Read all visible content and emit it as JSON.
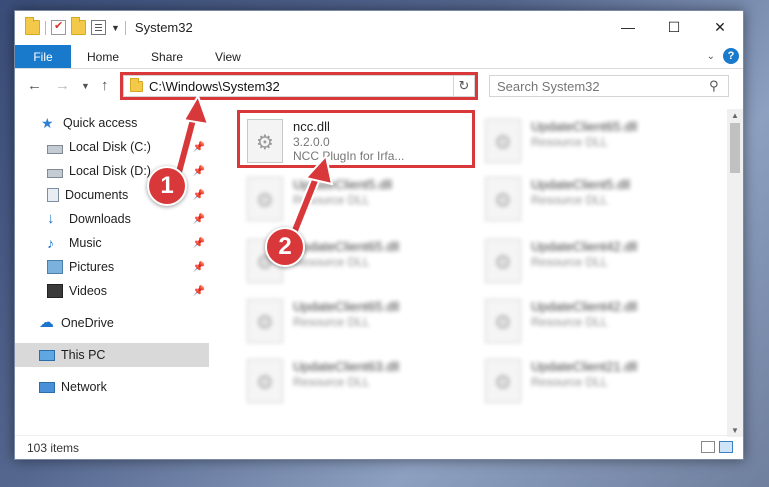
{
  "window": {
    "title": "System32",
    "controls": {
      "minimize": "—",
      "maximize": "☐",
      "close": "✕"
    }
  },
  "ribbon": {
    "tabs": [
      "File",
      "Home",
      "Share",
      "View"
    ],
    "help": "?"
  },
  "navigation": {
    "address": "C:\\Windows\\System32",
    "search_placeholder": "Search System32"
  },
  "sidebar": {
    "items": [
      {
        "label": "Quick access",
        "icon": "star-icon"
      },
      {
        "label": "Local Disk (C:)",
        "icon": "drive-icon",
        "pinned": true
      },
      {
        "label": "Local Disk (D:)",
        "icon": "drive-icon",
        "pinned": true
      },
      {
        "label": "Documents",
        "icon": "documents-icon",
        "pinned": true
      },
      {
        "label": "Downloads",
        "icon": "downloads-icon",
        "pinned": true
      },
      {
        "label": "Music",
        "icon": "music-icon",
        "pinned": true
      },
      {
        "label": "Pictures",
        "icon": "pictures-icon",
        "pinned": true
      },
      {
        "label": "Videos",
        "icon": "videos-icon",
        "pinned": true
      },
      {
        "label": "OneDrive",
        "icon": "onedrive-icon"
      },
      {
        "label": "This PC",
        "icon": "pc-icon",
        "selected": true
      },
      {
        "label": "Network",
        "icon": "network-icon"
      }
    ]
  },
  "files": [
    {
      "name": "ncc.dll",
      "version": "3.2.0.0",
      "description": "NCC PlugIn for Irfa..."
    },
    {
      "name": "UpdateClient65.dll",
      "description": "Resource DLL"
    },
    {
      "name": "UpdateClient5.dll",
      "description": "Resource DLL"
    },
    {
      "name": "UpdateClient5.dll",
      "description": "Resource DLL"
    },
    {
      "name": "UpdateClient65.dll",
      "description": "Resource DLL"
    },
    {
      "name": "UpdateClient42.dll",
      "description": "Resource DLL"
    },
    {
      "name": "UpdateClient65.dll",
      "description": "Resource DLL"
    },
    {
      "name": "UpdateClient42.dll",
      "description": "Resource DLL"
    },
    {
      "name": "UpdateClient63.dll",
      "description": "Resource DLL"
    },
    {
      "name": "UpdateClient21.dll",
      "description": "Resource DLL"
    }
  ],
  "status": {
    "count": "103 items"
  },
  "annotations": {
    "step1": "1",
    "step2": "2",
    "color": "#d9383a"
  },
  "colors": {
    "accent": "#1979ca",
    "highlight": "#d9383a"
  }
}
